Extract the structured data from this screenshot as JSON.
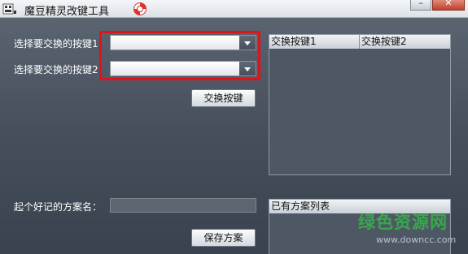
{
  "window": {
    "title": "魔豆精灵改键工具",
    "app_icon": "keyboard-icon",
    "help_icon": "lifebuoy-icon",
    "controls": {
      "minimize": "–",
      "close": "✕"
    }
  },
  "form": {
    "key1_label": "选择要交换的按键1",
    "key1_value": "",
    "key2_label": "选择要交换的按键2",
    "key2_value": "",
    "swap_button": "交换按键",
    "scheme_name_label": "起个好记的方案名：",
    "scheme_name_value": "",
    "save_button": "保存方案"
  },
  "swap_table": {
    "columns": [
      "交换按键1",
      "交换按键2"
    ],
    "rows": []
  },
  "scheme_list": {
    "header": "已有方案列表",
    "items": []
  },
  "watermark": {
    "site_name": "绿色资源网",
    "url": "www.downcc.com",
    "color": "#36b04a"
  },
  "colors": {
    "highlight": "#e0131b",
    "titlebar": "#e8ecf0"
  }
}
